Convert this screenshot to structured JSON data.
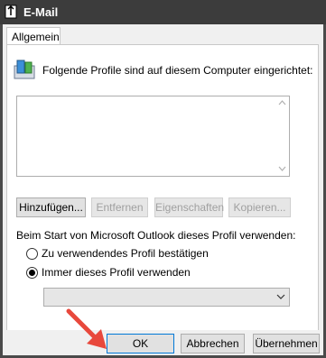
{
  "window": {
    "title": "E-Mail"
  },
  "tabs": [
    {
      "label": "Allgemein"
    }
  ],
  "profiles": {
    "intro_text": "Folgende Profile sind auf diesem Computer eingerichtet:",
    "items": []
  },
  "buttons": {
    "add": "Hinzufügen...",
    "remove": "Entfernen",
    "properties": "Eigenschaften",
    "copy": "Kopieren..."
  },
  "startup": {
    "label": "Beim Start von Microsoft Outlook dieses Profil verwenden:",
    "option_confirm": "Zu verwendendes Profil bestätigen",
    "option_always": "Immer dieses Profil verwenden",
    "selected_option": "always",
    "profile_select_value": ""
  },
  "footer": {
    "ok": "OK",
    "cancel": "Abbrechen",
    "apply": "Übernehmen"
  },
  "colors": {
    "annotation_arrow": "#e8483c",
    "focus_border": "#0078d7"
  }
}
